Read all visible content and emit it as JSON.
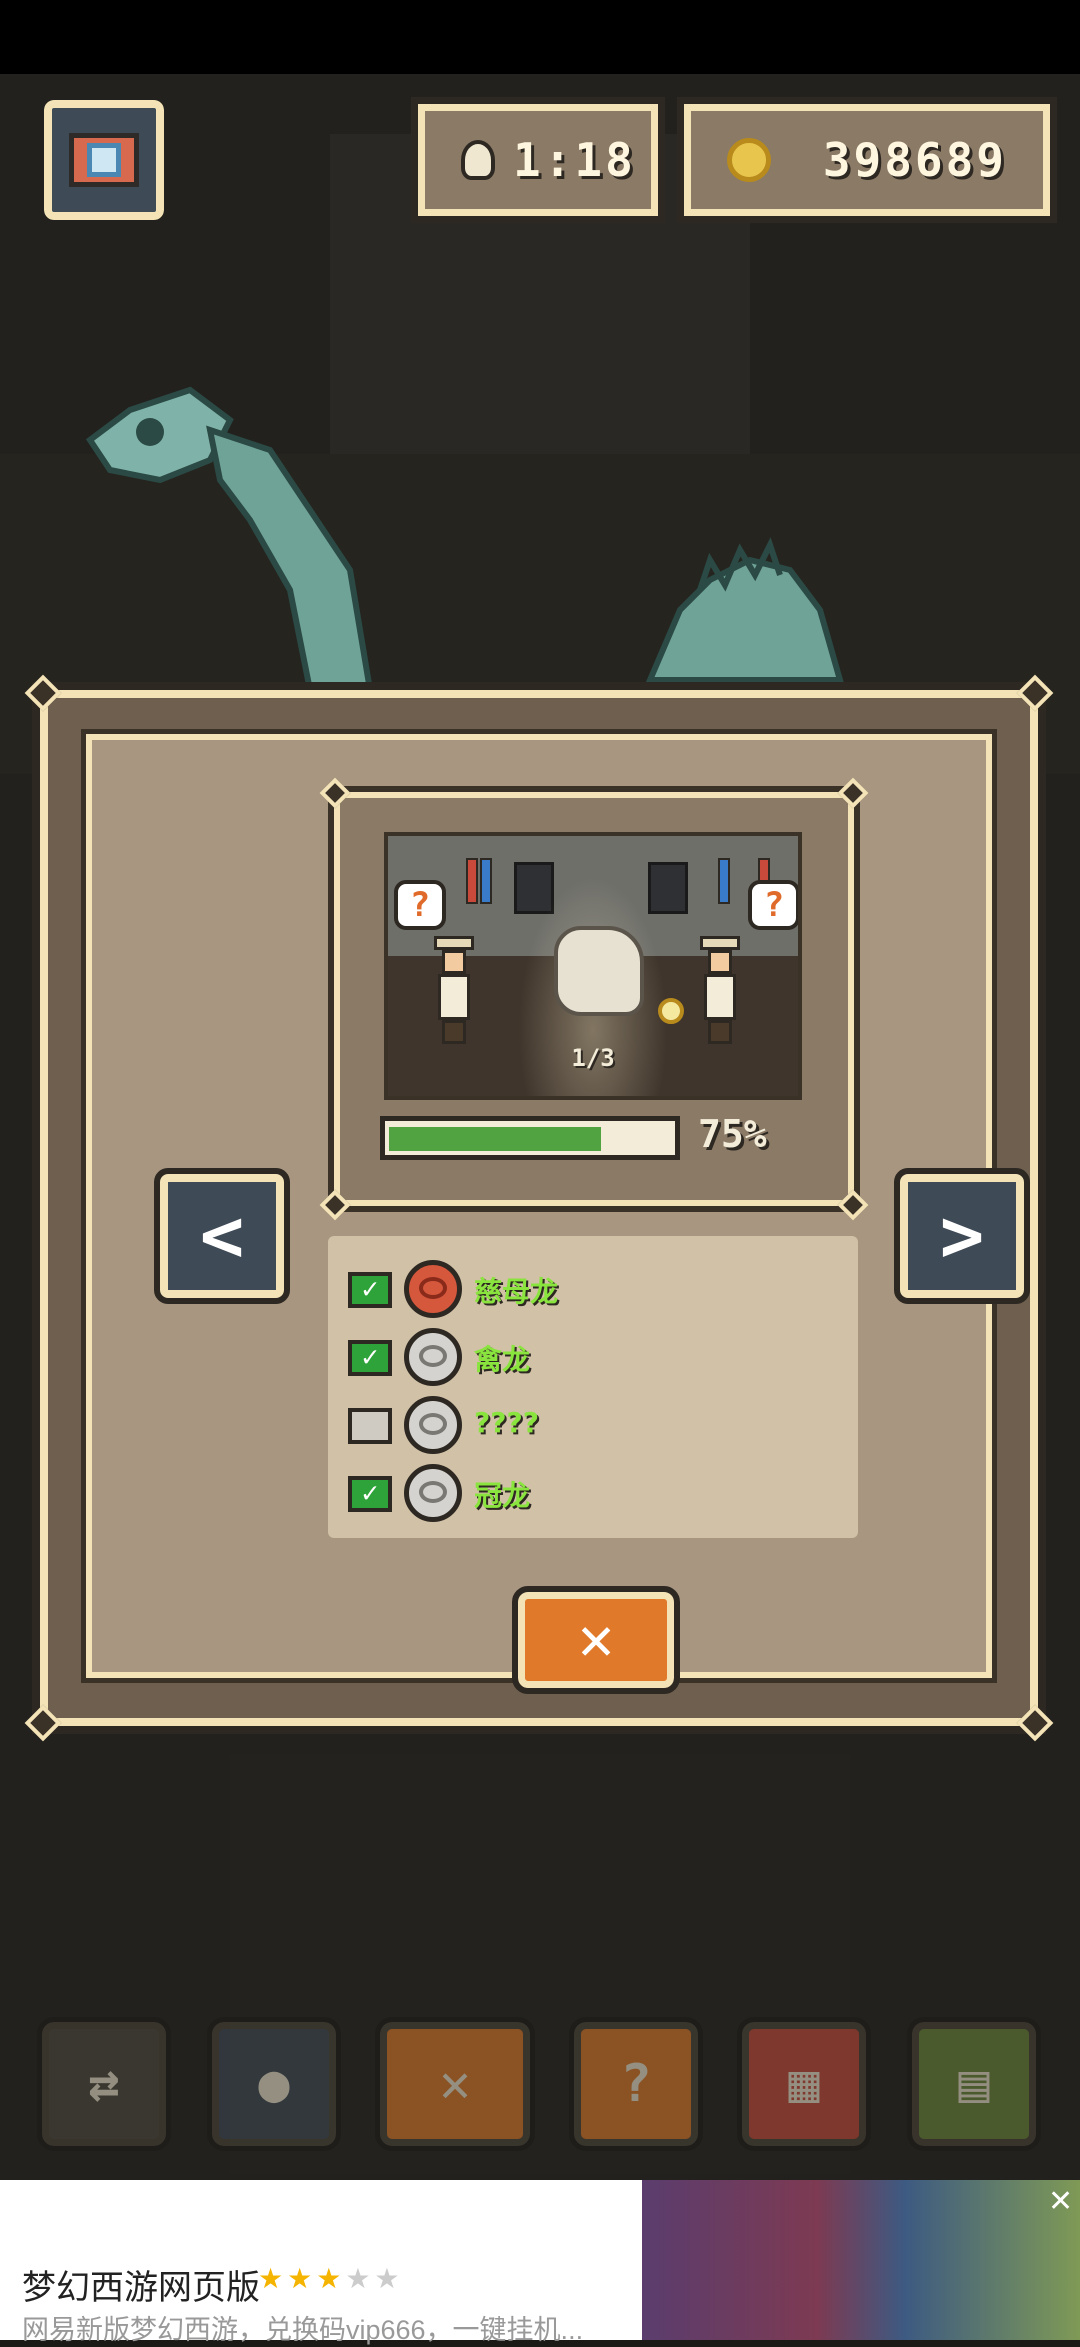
{
  "hud": {
    "timer": "1:18",
    "coins": "398689"
  },
  "modal": {
    "image_page": "1/3",
    "progress_percent": 75,
    "progress_label": "75%",
    "prev_label": "<",
    "next_label": ">",
    "close_label": "✕",
    "items": [
      {
        "name": "慈母龙",
        "checked": true,
        "icon": "fossil-red-icon"
      },
      {
        "name": "禽龙",
        "checked": true,
        "icon": "fossil-gray-icon"
      },
      {
        "name": "????",
        "checked": false,
        "icon": "fossil-gray-icon"
      },
      {
        "name": "冠龙",
        "checked": true,
        "icon": "fossil-gray-icon"
      }
    ]
  },
  "toolbar": {
    "items": [
      "swap-icon",
      "lightbulb-icon",
      "close-icon",
      "magnifier-question-icon",
      "map-icon",
      "book-icon"
    ],
    "close_label": "✕"
  },
  "ad": {
    "title": "梦幻西游网页版",
    "rating": 3,
    "rating_max": 5,
    "stars_on": "★★★",
    "stars_off": "★★",
    "description": "网易新版梦幻西游，兑换码vip666，一键挂机...",
    "close_label": "✕"
  },
  "colors": {
    "frame_light": "#f3e3b6",
    "frame_dark": "#2d2822",
    "check_green": "#2ea33a",
    "name_green": "#8ae43e",
    "close_orange": "#e07a2a",
    "progress_green": "#51a342"
  }
}
